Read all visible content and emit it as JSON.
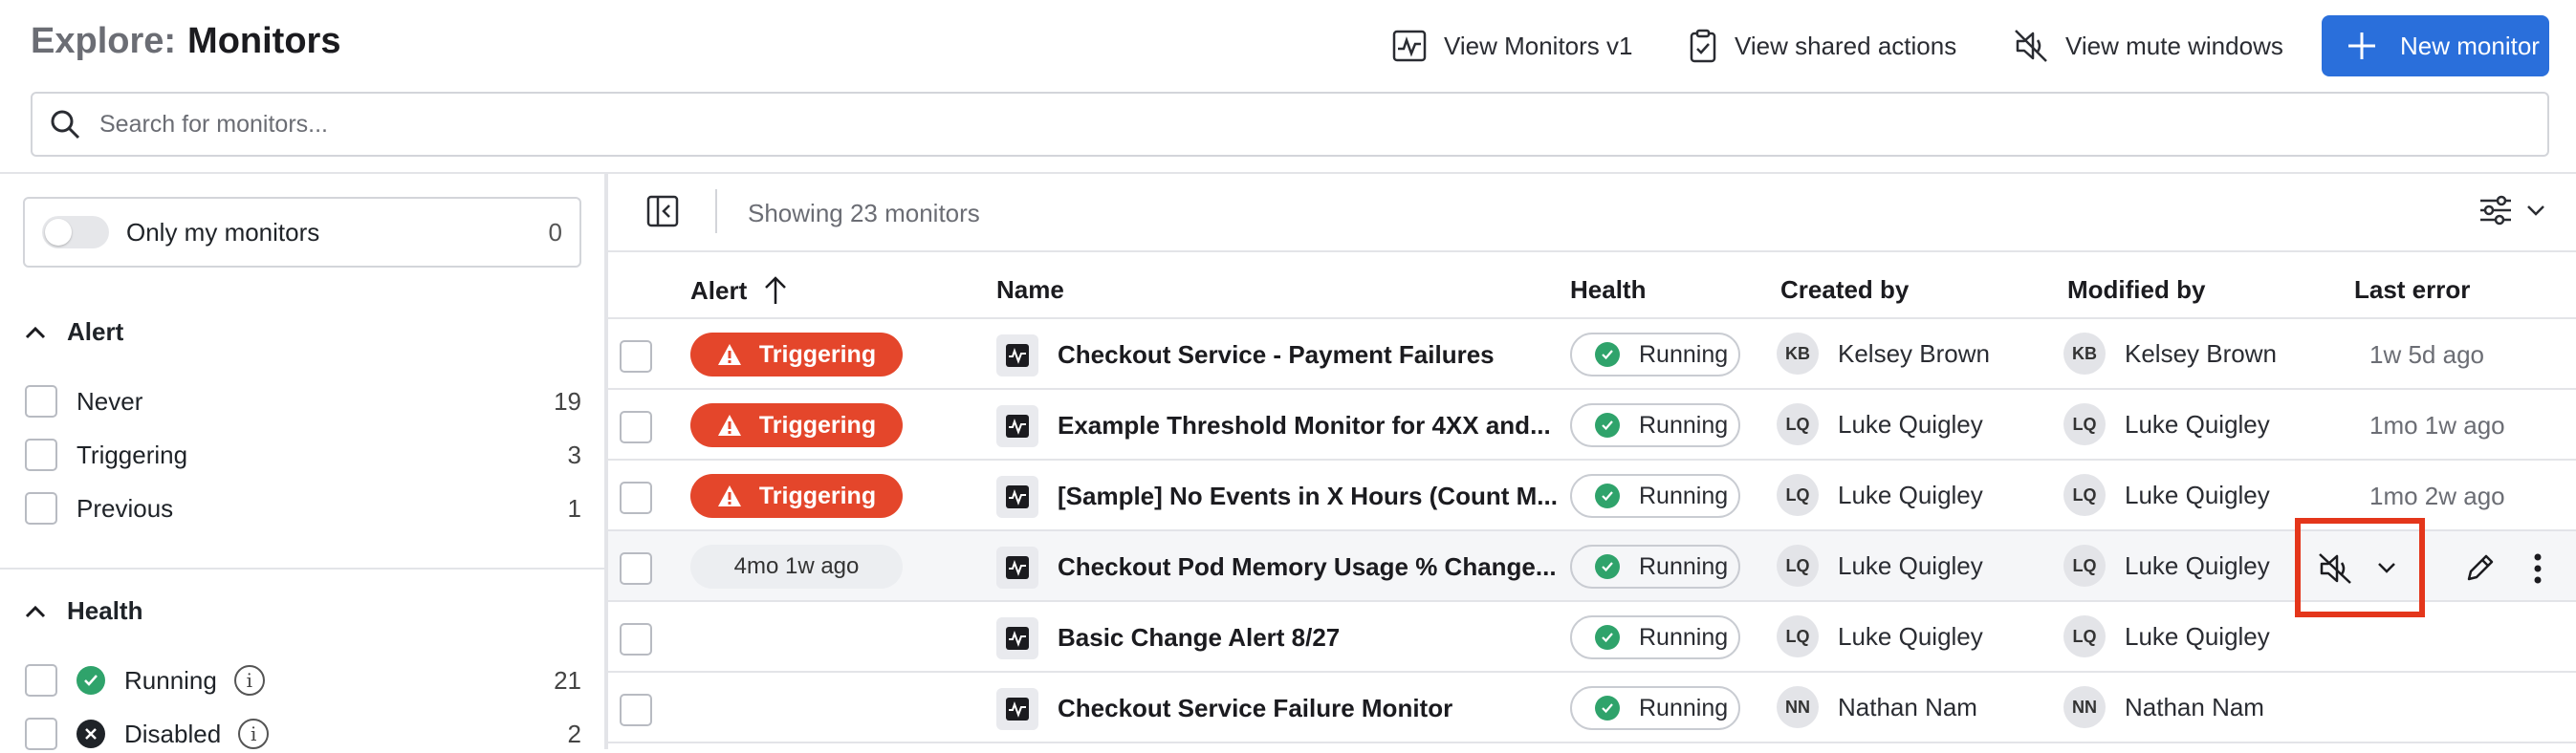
{
  "header": {
    "title_prefix": "Explore:",
    "title": "Monitors",
    "view_v1": "View Monitors v1",
    "view_shared": "View shared actions",
    "view_mute": "View mute windows",
    "new_monitor": "New monitor",
    "accent_color": "#2a6fdb"
  },
  "search": {
    "placeholder": "Search for monitors..."
  },
  "sidebar": {
    "only_mine_label": "Only my monitors",
    "only_mine_count": "0",
    "alert_section": "Alert",
    "alert_items": [
      {
        "label": "Never",
        "count": "19"
      },
      {
        "label": "Triggering",
        "count": "3"
      },
      {
        "label": "Previous",
        "count": "1"
      }
    ],
    "health_section": "Health",
    "health_items": [
      {
        "label": "Running",
        "count": "21",
        "status_color": "#2fa36b"
      },
      {
        "label": "Disabled",
        "count": "2",
        "status_color": "#1f2328"
      }
    ]
  },
  "toolbar": {
    "showing": "Showing 23 monitors"
  },
  "table": {
    "columns": {
      "alert": "Alert",
      "name": "Name",
      "health": "Health",
      "created_by": "Created by",
      "modified_by": "Modified by",
      "last_error": "Last error"
    },
    "rows": [
      {
        "alert": "Triggering",
        "name": "Checkout Service - Payment Failures",
        "health": "Running",
        "created_initials": "KB",
        "created_by": "Kelsey Brown",
        "modified_initials": "KB",
        "modified_by": "Kelsey Brown",
        "last_error": "1w 5d ago"
      },
      {
        "alert": "Triggering",
        "name": "Example Threshold Monitor for 4XX and...",
        "health": "Running",
        "created_initials": "LQ",
        "created_by": "Luke Quigley",
        "modified_initials": "LQ",
        "modified_by": "Luke Quigley",
        "last_error": "1mo 1w ago"
      },
      {
        "alert": "Triggering",
        "name": "[Sample] No Events in X Hours (Count M...",
        "health": "Running",
        "created_initials": "LQ",
        "created_by": "Luke Quigley",
        "modified_initials": "LQ",
        "modified_by": "Luke Quigley",
        "last_error": "1mo 2w ago"
      },
      {
        "alert": "4mo 1w ago",
        "name": "Checkout Pod Memory Usage % Change...",
        "health": "Running",
        "created_initials": "LQ",
        "created_by": "Luke Quigley",
        "modified_initials": "LQ",
        "modified_by": "Luke Quigley",
        "last_error": ""
      },
      {
        "alert": "",
        "name": "Basic Change Alert 8/27",
        "health": "Running",
        "created_initials": "LQ",
        "created_by": "Luke Quigley",
        "modified_initials": "LQ",
        "modified_by": "Luke Quigley",
        "last_error": ""
      },
      {
        "alert": "",
        "name": "Checkout Service Failure Monitor",
        "health": "Running",
        "created_initials": "NN",
        "created_by": "Nathan Nam",
        "modified_initials": "NN",
        "modified_by": "Nathan Nam",
        "last_error": ""
      }
    ]
  },
  "colors": {
    "triggering": "#e4462b",
    "running": "#2fa36b",
    "highlight": "#e4361b"
  }
}
